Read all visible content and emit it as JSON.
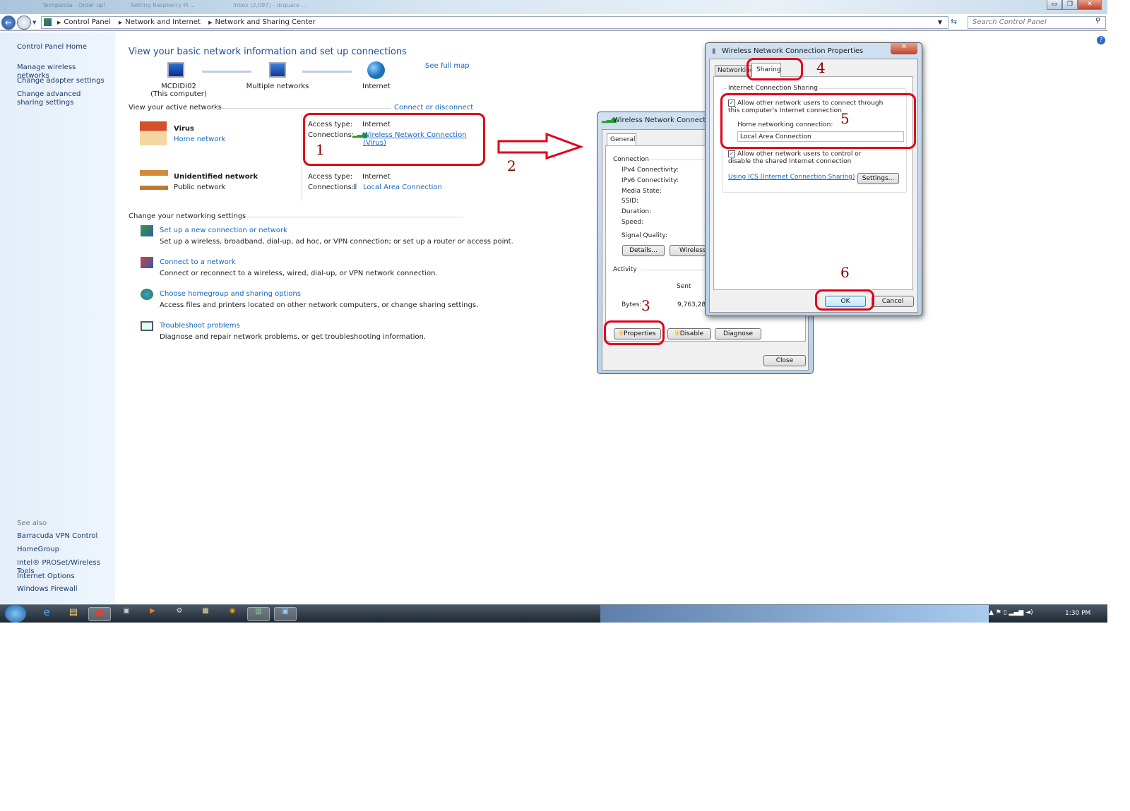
{
  "window": {
    "tabs": [
      "Techpanda - Order up!",
      "Setting Raspberry Pi ...",
      "Inbox (2,097) - dsquare ..."
    ],
    "controls": {
      "minimize": "▭",
      "restore": "❐",
      "close": "✕"
    }
  },
  "address_bar": {
    "breadcrumbs": [
      "Control Panel",
      "Network and Internet",
      "Network and Sharing Center"
    ],
    "search_placeholder": "Search Control Panel"
  },
  "sidebar": {
    "items": [
      "Control Panel Home",
      "Manage wireless networks",
      "Change adapter settings",
      "Change advanced sharing settings"
    ],
    "see_also_label": "See also",
    "see_also": [
      "Barracuda VPN Control",
      "HomeGroup",
      "Intel® PROSet/Wireless Tools",
      "Internet Options",
      "Windows Firewall"
    ]
  },
  "main": {
    "title": "View your basic network information and set up connections",
    "see_full_map": "See full map",
    "map": [
      {
        "label": "MCDIDI02",
        "sub": "(This computer)"
      },
      {
        "label": "Multiple networks"
      },
      {
        "label": "Internet"
      }
    ],
    "active_label": "View your active networks",
    "connect_disconnect": "Connect or disconnect",
    "networks": [
      {
        "name": "Virus",
        "type": "Home network",
        "access_label": "Access type:",
        "access": "Internet",
        "conn_label": "Connections:",
        "conn": "Wireless Network Connection",
        "conn2": "(Virus)"
      },
      {
        "name": "Unidentified network",
        "type": "Public network",
        "access_label": "Access type:",
        "access": "Internet",
        "conn_label": "Connections:",
        "conn": "Local Area Connection"
      }
    ],
    "change_label": "Change your networking settings",
    "tasks": [
      {
        "title": "Set up a new connection or network",
        "desc": "Set up a wireless, broadband, dial-up, ad hoc, or VPN connection; or set up a router or access point."
      },
      {
        "title": "Connect to a network",
        "desc": "Connect or reconnect to a wireless, wired, dial-up, or VPN network connection."
      },
      {
        "title": "Choose homegroup and sharing options",
        "desc": "Access files and printers located on other network computers, or change sharing settings."
      },
      {
        "title": "Troubleshoot problems",
        "desc": "Diagnose and repair network problems, or get troubleshooting information."
      }
    ]
  },
  "status_dialog": {
    "title": "Wireless Network Connection",
    "tab": "General",
    "connection_label": "Connection",
    "fields": [
      "IPv4 Connectivity:",
      "IPv6 Connectivity:",
      "Media State:",
      "SSID:",
      "Duration:",
      "Speed:"
    ],
    "signal": "Signal Quality:",
    "details": "Details...",
    "wireless": "Wireless Properties",
    "activity": "Activity",
    "sent": "Sent",
    "bytes_label": "Bytes:",
    "bytes_sent": "9,763,283",
    "properties": "Properties",
    "disable": "Disable",
    "diagnose": "Diagnose",
    "close": "Close"
  },
  "props_dialog": {
    "title": "Wireless Network Connection Properties",
    "tabs": [
      "Networking",
      "Sharing"
    ],
    "group": "Internet Connection Sharing",
    "allow_connect": "Allow other network users to connect through this computer's Internet connection",
    "allow_connect_checked": true,
    "home_label": "Home networking connection:",
    "home_value": "Local Area Connection",
    "allow_control": "Allow other network users to control or disable the shared Internet connection",
    "allow_control_checked": true,
    "ics_link": "Using ICS (Internet Connection Sharing)",
    "settings": "Settings...",
    "ok": "OK",
    "cancel": "Cancel"
  },
  "annotations": [
    "1",
    "2",
    "3",
    "4",
    "5",
    "6"
  ],
  "taskbar": {
    "clock": "1:30 PM"
  },
  "colors": {
    "annotation_red": "#e0001a",
    "link_blue": "#1565c0"
  }
}
